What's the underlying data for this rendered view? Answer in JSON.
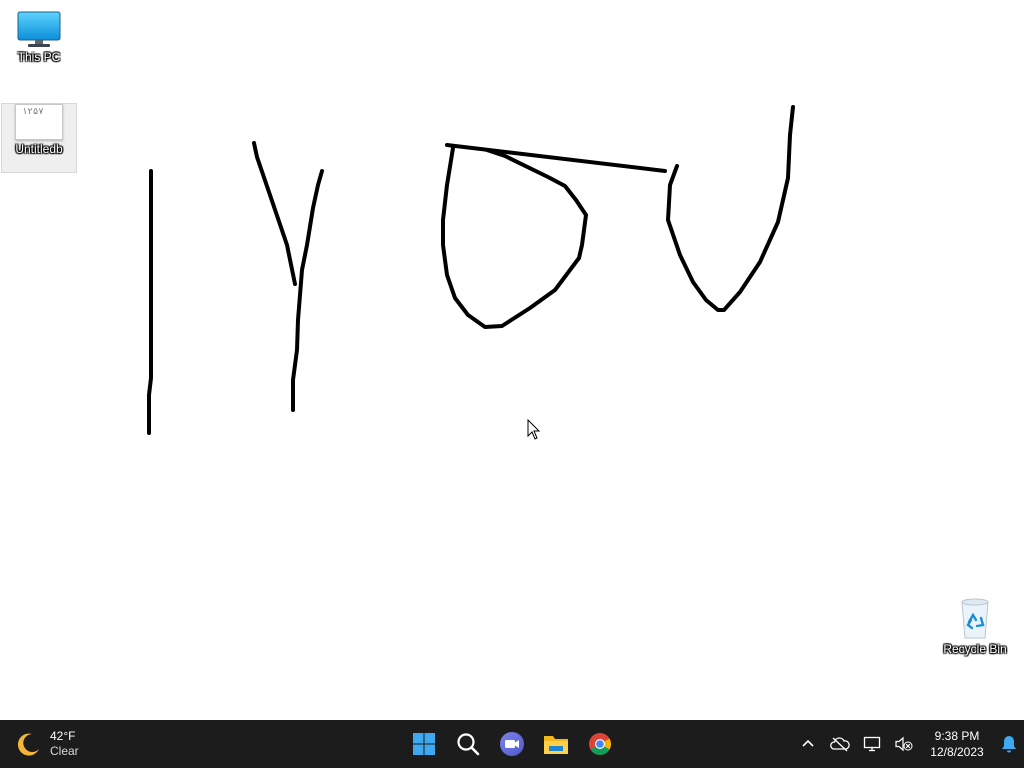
{
  "desktop": {
    "icons": [
      {
        "label": "This PC",
        "icon": "this-pc-icon"
      },
      {
        "label": "Untitledb",
        "icon": "image-file-icon",
        "thumbnail_text": "۱۲۵۷"
      },
      {
        "label": "Recycle Bin",
        "icon": "recycle-bin-icon"
      }
    ],
    "background_color": "#ffffff",
    "ink_color": "#000000",
    "drawing_content": "handwritten strokes resembling ۱۲۵۷"
  },
  "taskbar": {
    "background_color": "#1c1c1c",
    "weather": {
      "temp": "42°F",
      "condition": "Clear",
      "icon": "moon-icon"
    },
    "apps": [
      {
        "name": "Start",
        "icon": "windows-start-icon"
      },
      {
        "name": "Search",
        "icon": "search-icon"
      },
      {
        "name": "Meet",
        "icon": "video-chat-icon"
      },
      {
        "name": "File Explorer",
        "icon": "folder-icon"
      },
      {
        "name": "Google Chrome",
        "icon": "chrome-icon"
      }
    ],
    "tray": {
      "icons": [
        "chevron-up-icon",
        "onedrive-offline-icon",
        "network-icon",
        "volume-muted-icon"
      ],
      "time": "9:38 PM",
      "date": "12/8/2023",
      "notification_icon": "bell-icon"
    }
  }
}
